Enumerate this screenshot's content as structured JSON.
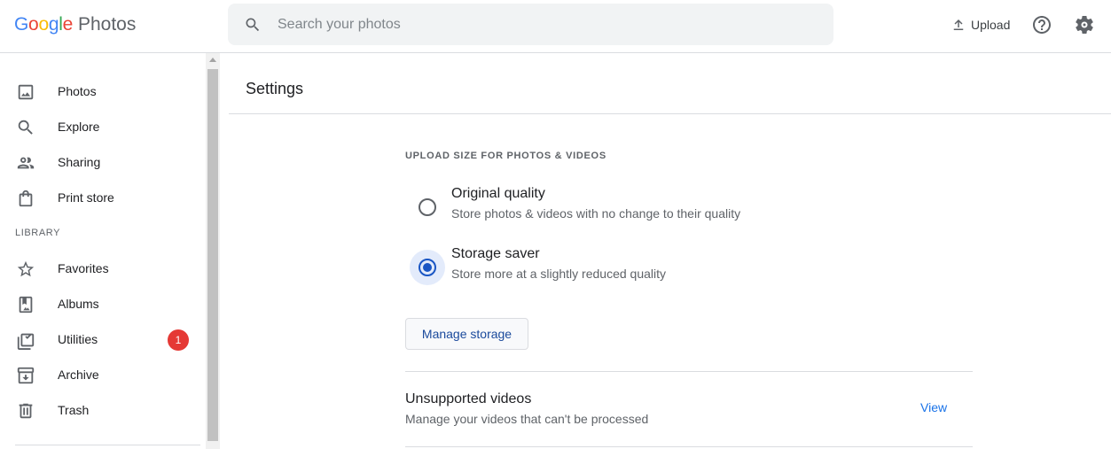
{
  "header": {
    "logo": {
      "letters": [
        "G",
        "o",
        "o",
        "g",
        "l",
        "e"
      ],
      "product": "Photos"
    },
    "search": {
      "placeholder": "Search your photos",
      "icon": "search-icon"
    },
    "upload_label": "Upload",
    "help_icon": "help-icon",
    "settings_icon": "gear-icon"
  },
  "sidebar": {
    "items": [
      {
        "label": "Photos",
        "icon": "photo-icon"
      },
      {
        "label": "Explore",
        "icon": "search-icon"
      },
      {
        "label": "Sharing",
        "icon": "people-icon"
      },
      {
        "label": "Print store",
        "icon": "shopping-bag-icon"
      }
    ],
    "library_label": "LIBRARY",
    "library_items": [
      {
        "label": "Favorites",
        "icon": "star-icon"
      },
      {
        "label": "Albums",
        "icon": "album-icon"
      },
      {
        "label": "Utilities",
        "icon": "utilities-icon",
        "badge": "1"
      },
      {
        "label": "Archive",
        "icon": "archive-icon"
      },
      {
        "label": "Trash",
        "icon": "trash-icon"
      }
    ]
  },
  "main": {
    "title": "Settings",
    "upload_section": {
      "heading": "UPLOAD SIZE FOR PHOTOS & VIDEOS",
      "options": [
        {
          "title": "Original quality",
          "description": "Store photos & videos with no change to their quality",
          "selected": false
        },
        {
          "title": "Storage saver",
          "description": "Store more at a slightly reduced quality",
          "selected": true
        }
      ],
      "manage_button": "Manage storage"
    },
    "unsupported_videos": {
      "title": "Unsupported videos",
      "description": "Manage your videos that can't be processed",
      "action": "View"
    }
  },
  "colors": {
    "accent": "#1a73e8",
    "radio_selected": "#1a56c4",
    "badge": "#e53935"
  }
}
